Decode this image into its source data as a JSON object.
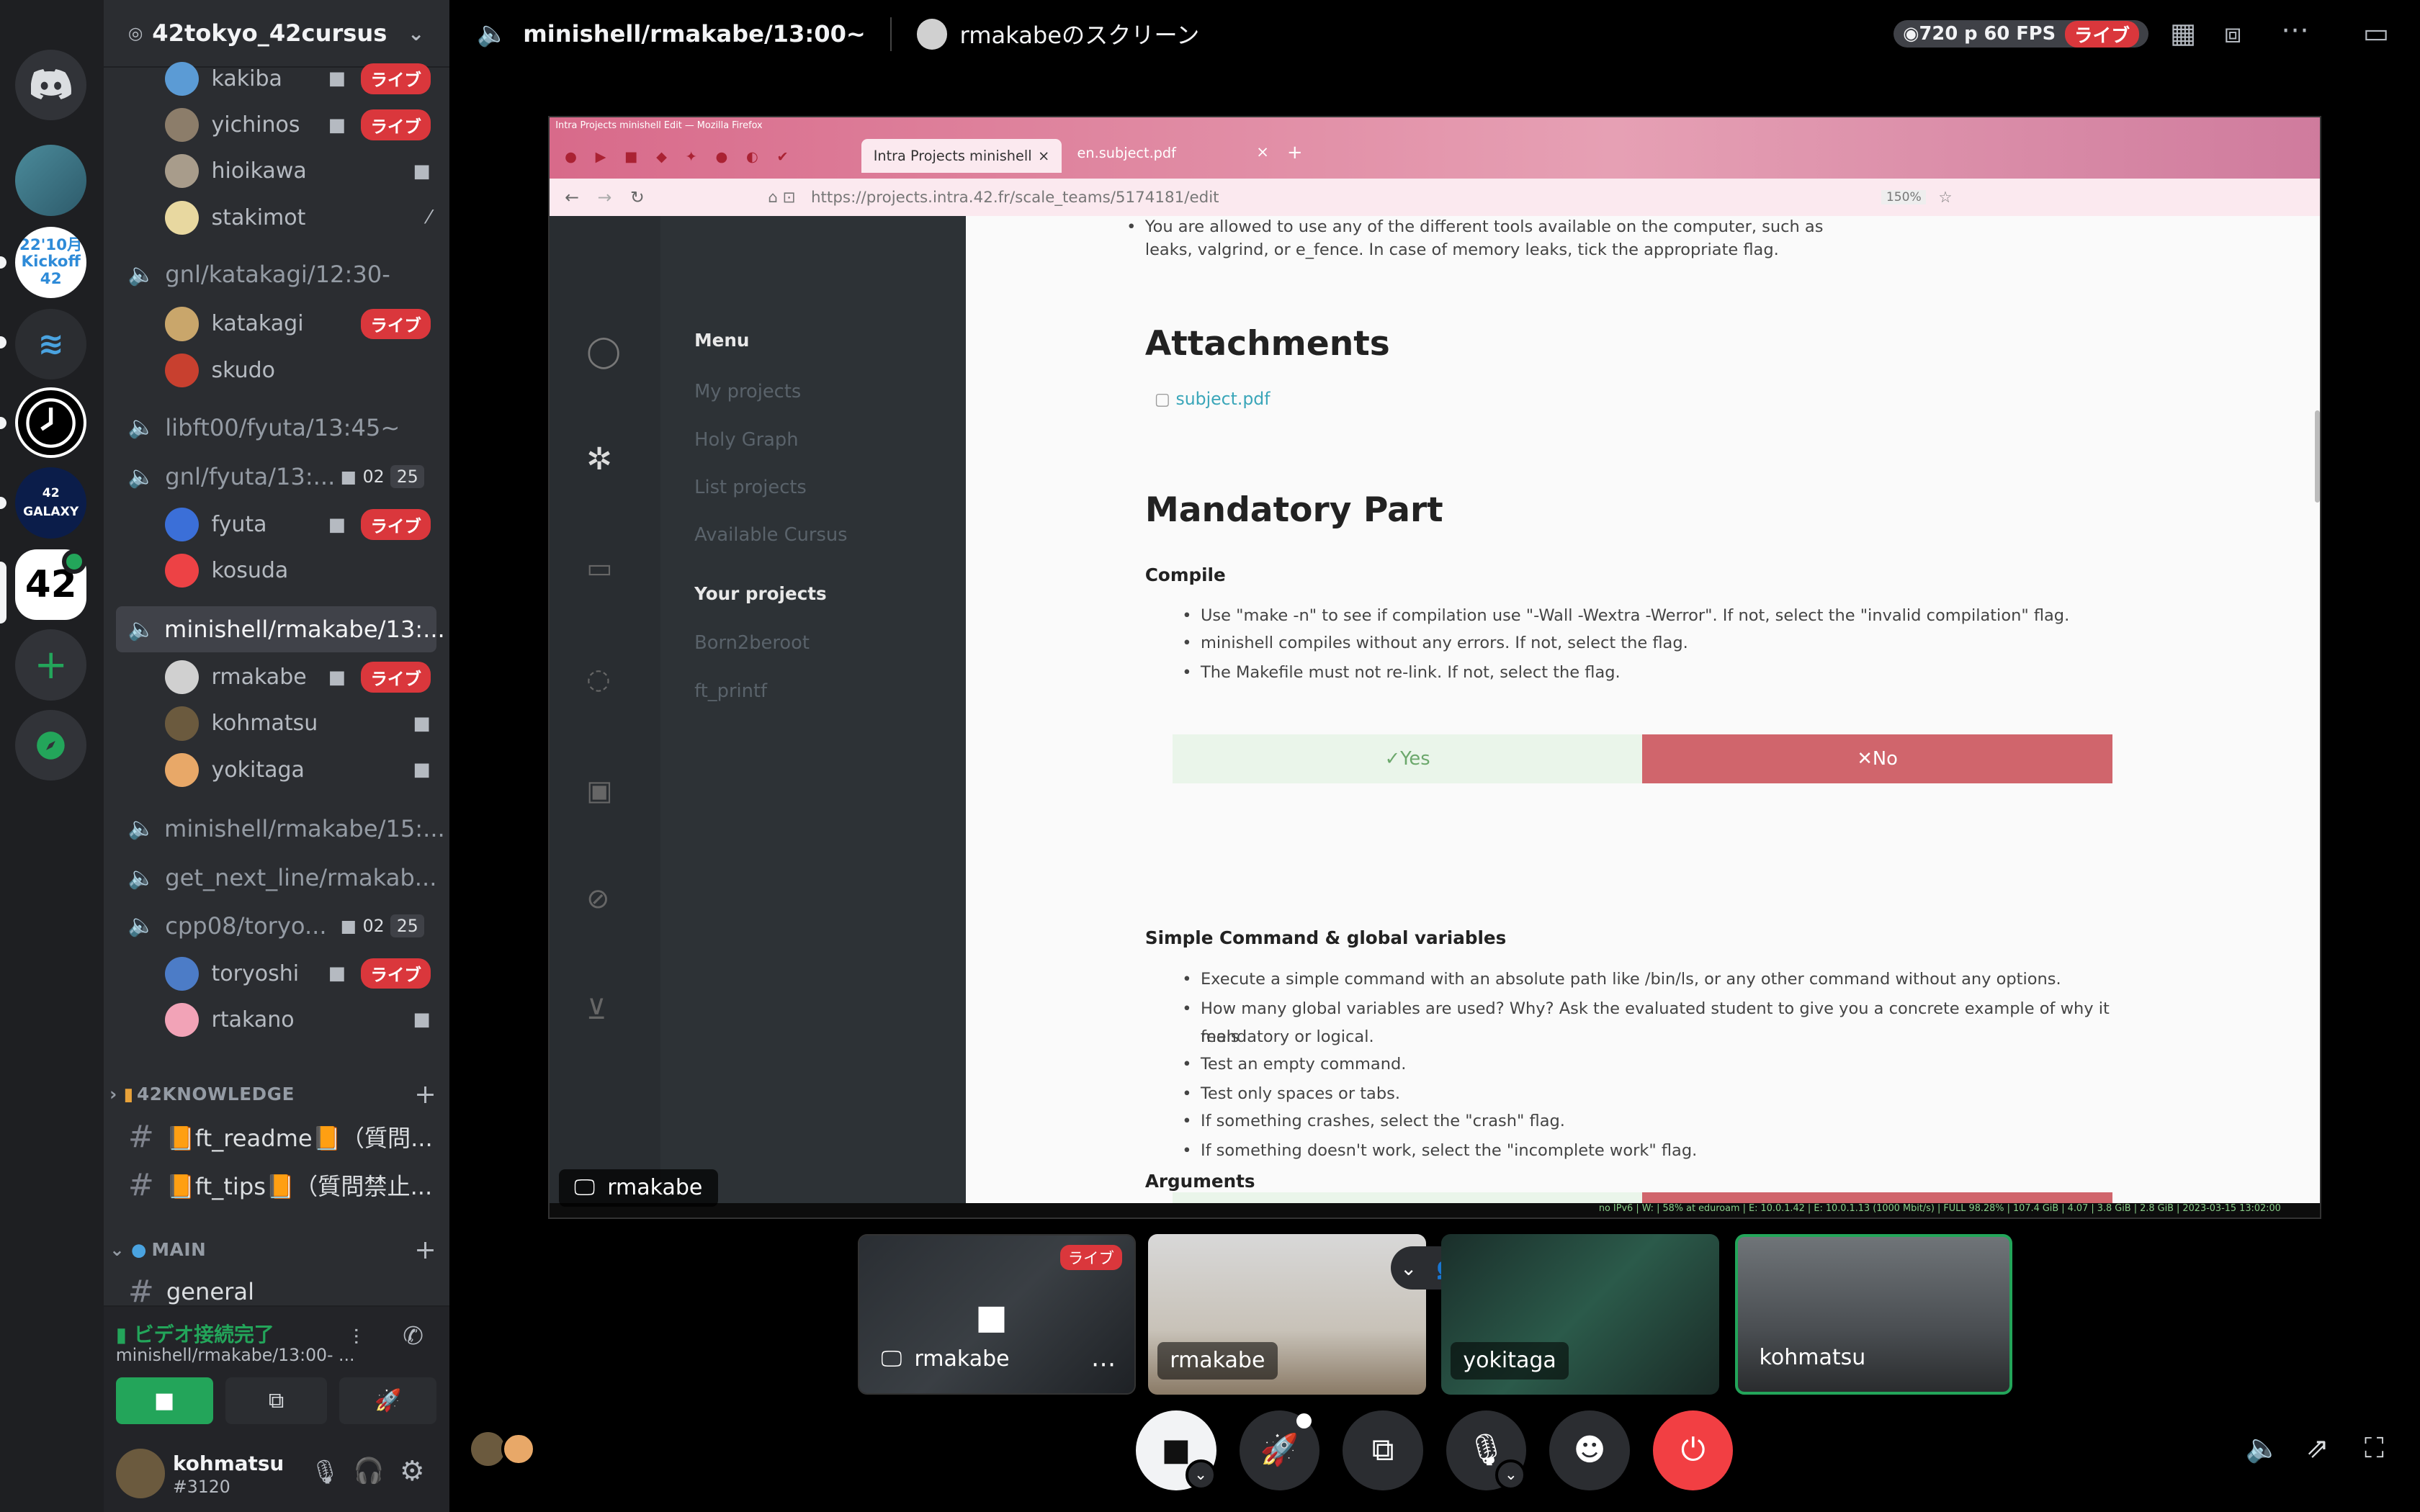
{
  "server": {
    "name": "42tokyo_42cursus"
  },
  "rail": {
    "items": [
      "discord-home",
      "server-1",
      "22'10月 Kickoff 42",
      "aimii",
      "clock",
      "42 GALAXY",
      "42 東京",
      "add-server",
      "explore"
    ],
    "kickoff_label": "22'10月 Kickoff 42",
    "galaxy_label": "42 GALAXY",
    "tokyo_label": "42"
  },
  "channels": {
    "top_users": [
      {
        "name": "kakiba",
        "live": true,
        "cam": true
      },
      {
        "name": "yichinos",
        "live": true,
        "cam": true
      },
      {
        "name": "hioikawa",
        "live": false,
        "cam": true
      },
      {
        "name": "stakimot",
        "live": false,
        "cam": false
      }
    ],
    "katakagi": {
      "name": "gnl/katakagi/12:30-",
      "users": [
        {
          "name": "katakagi",
          "live": true
        },
        {
          "name": "skudo",
          "live": false
        }
      ]
    },
    "libft": {
      "name": "libft00/fyuta/13:45~"
    },
    "gnlfyuta": {
      "name": "gnl/fyuta/13:...",
      "c1": "02",
      "c2": "25",
      "users": [
        {
          "name": "fyuta",
          "live": true
        },
        {
          "name": "kosuda",
          "live": false
        }
      ]
    },
    "minishell": {
      "name": "minishell/rmakabe/13:...",
      "users": [
        {
          "name": "rmakabe",
          "live": true
        },
        {
          "name": "kohmatsu",
          "live": false
        },
        {
          "name": "yokitaga",
          "live": false
        }
      ]
    },
    "minishell2": {
      "name": "minishell/rmakabe/15:..."
    },
    "gnl2": {
      "name": "get_next_line/rmakab..."
    },
    "cpp": {
      "name": "cpp08/toryo...",
      "c1": "02",
      "c2": "25",
      "users": [
        {
          "name": "toryoshi",
          "live": true
        },
        {
          "name": "rtakano",
          "live": false
        }
      ]
    },
    "live_label": "ライブ"
  },
  "categories": {
    "knowledge": {
      "label": "42KNOWLEDGE",
      "channels": [
        "📙ft_readme📙（質問...",
        "📙ft_tips📙（質問禁止..."
      ]
    },
    "main": {
      "label": "MAIN",
      "channels": [
        "general"
      ]
    }
  },
  "voice_panel": {
    "status": "ビデオ接続完了",
    "channel": "minishell/rmakabe/13:00- ..."
  },
  "user": {
    "name": "kohmatsu",
    "tag": "#3120"
  },
  "topbar": {
    "channel": "minishell/rmakabe/13:00~",
    "screen_owner": "rmakabeのスクリーン",
    "quality": "720 p 60 FPS",
    "live": "ライブ"
  },
  "screen": {
    "window_title": "Intra Projects minishell Edit — Mozilla Firefox",
    "tabs": [
      "Intra Projects minishell",
      "en.subject.pdf"
    ],
    "url": "https://projects.intra.42.fr/scale_teams/5174181/edit",
    "zoom": "150%",
    "menu_title": "Menu",
    "menu_items": [
      "My projects",
      "Holy Graph",
      "List projects",
      "Available Cursus"
    ],
    "your_projects_title": "Your projects",
    "projects": [
      "Born2beroot",
      "ft_printf"
    ],
    "intro_1": "You are allowed to use any of the different tools available on the computer, such as",
    "intro_2": "leaks, valgrind, or e_fence. In case of memory leaks, tick the appropriate flag.",
    "attachments_title": "Attachments",
    "attachment": "subject.pdf",
    "mandatory_title": "Mandatory Part",
    "compile_title": "Compile",
    "compile_items": [
      "Use \"make -n\" to see if compilation use \"-Wall -Wextra -Werror\". If not, select the \"invalid compilation\" flag.",
      "minishell compiles without any errors. If not, select the flag.",
      "The Makefile must not re-link. If not, select the flag."
    ],
    "yes": "Yes",
    "no": "No",
    "simple_title": "Simple Command & global variables",
    "simple_items": [
      "Execute a simple command with an absolute path like /bin/ls, or any other command without any options.",
      "How many global variables are used? Why? Ask the evaluated student to give you a concrete example of why it feels",
      "mandatory or logical.",
      "Test an empty command.",
      "Test only spaces or tabs.",
      "If something crashes, select the \"crash\" flag.",
      "If something doesn't work, select the \"incomplete work\" flag."
    ],
    "arguments_title": "Arguments",
    "status_line": "no IPv6 | W: | 58% at eduroam | E: 10.0.1.42 | E: 10.0.1.13 (1000 Mbit/s) | FULL 98.28% | 107.4 GiB | 4.07 | 3.8 GiB | 2.8 GiB | 2023-03-15 13:02:00"
  },
  "screen_label": "rmakabe",
  "tiles": [
    {
      "name": "rmakabe",
      "live": "ライブ"
    },
    {
      "name": "rmakabe"
    },
    {
      "name": "yokitaga"
    },
    {
      "name": "kohmatsu"
    }
  ],
  "colors": {
    "live": "#da373c",
    "green": "#23a55a",
    "end_call": "#f23f43",
    "no_button": "#d0656c"
  }
}
